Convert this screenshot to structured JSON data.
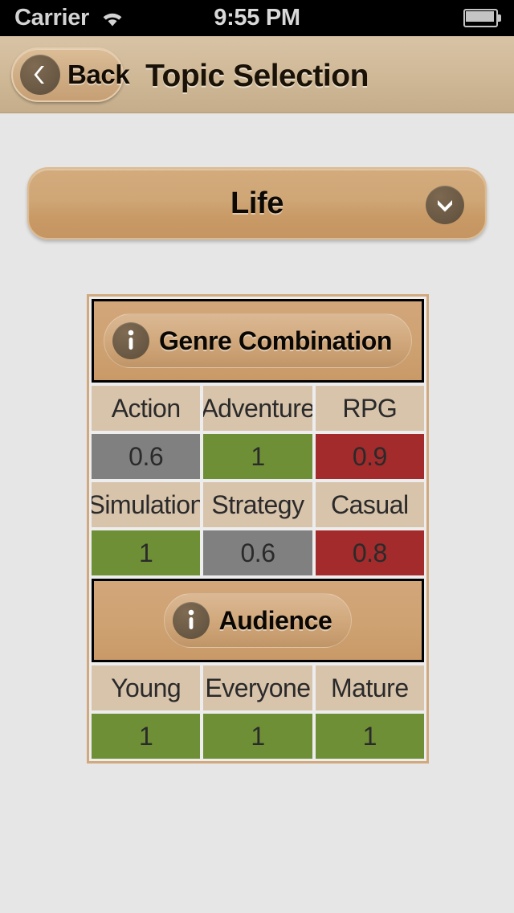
{
  "status_bar": {
    "carrier": "Carrier",
    "wifi_icon": "wifi-icon",
    "time": "9:55 PM",
    "battery_icon": "battery-full-icon"
  },
  "nav_bar": {
    "title": "Topic Selection",
    "back_label": "Back",
    "back_icon": "chevron-left-icon"
  },
  "topic_dropdown": {
    "selected": "Life",
    "chevron_icon": "chevron-down-icon"
  },
  "sections": [
    {
      "title": "Genre Combination",
      "info_icon": "info-icon",
      "rows": [
        {
          "labels": [
            "Action",
            "Adventure",
            "RPG"
          ],
          "values": [
            "0.6",
            "1",
            "0.9"
          ],
          "value_colors": [
            "gray",
            "green",
            "red"
          ]
        },
        {
          "labels": [
            "Simulation",
            "Strategy",
            "Casual"
          ],
          "values": [
            "1",
            "0.6",
            "0.8"
          ],
          "value_colors": [
            "green",
            "gray",
            "red"
          ]
        }
      ]
    },
    {
      "title": "Audience",
      "info_icon": "info-icon",
      "rows": [
        {
          "labels": [
            "Young",
            "Everyone",
            "Mature"
          ],
          "values": [
            "1",
            "1",
            "1"
          ],
          "value_colors": [
            "green",
            "green",
            "green"
          ]
        }
      ]
    }
  ],
  "colors": {
    "green": "#6e8f35",
    "gray": "#808080",
    "red": "#a32b2b",
    "label_cell": "#d8c3ab",
    "tan_accent": "#cea272",
    "nav_bar": "#cfb896",
    "body_bg": "#e6e6e6"
  }
}
